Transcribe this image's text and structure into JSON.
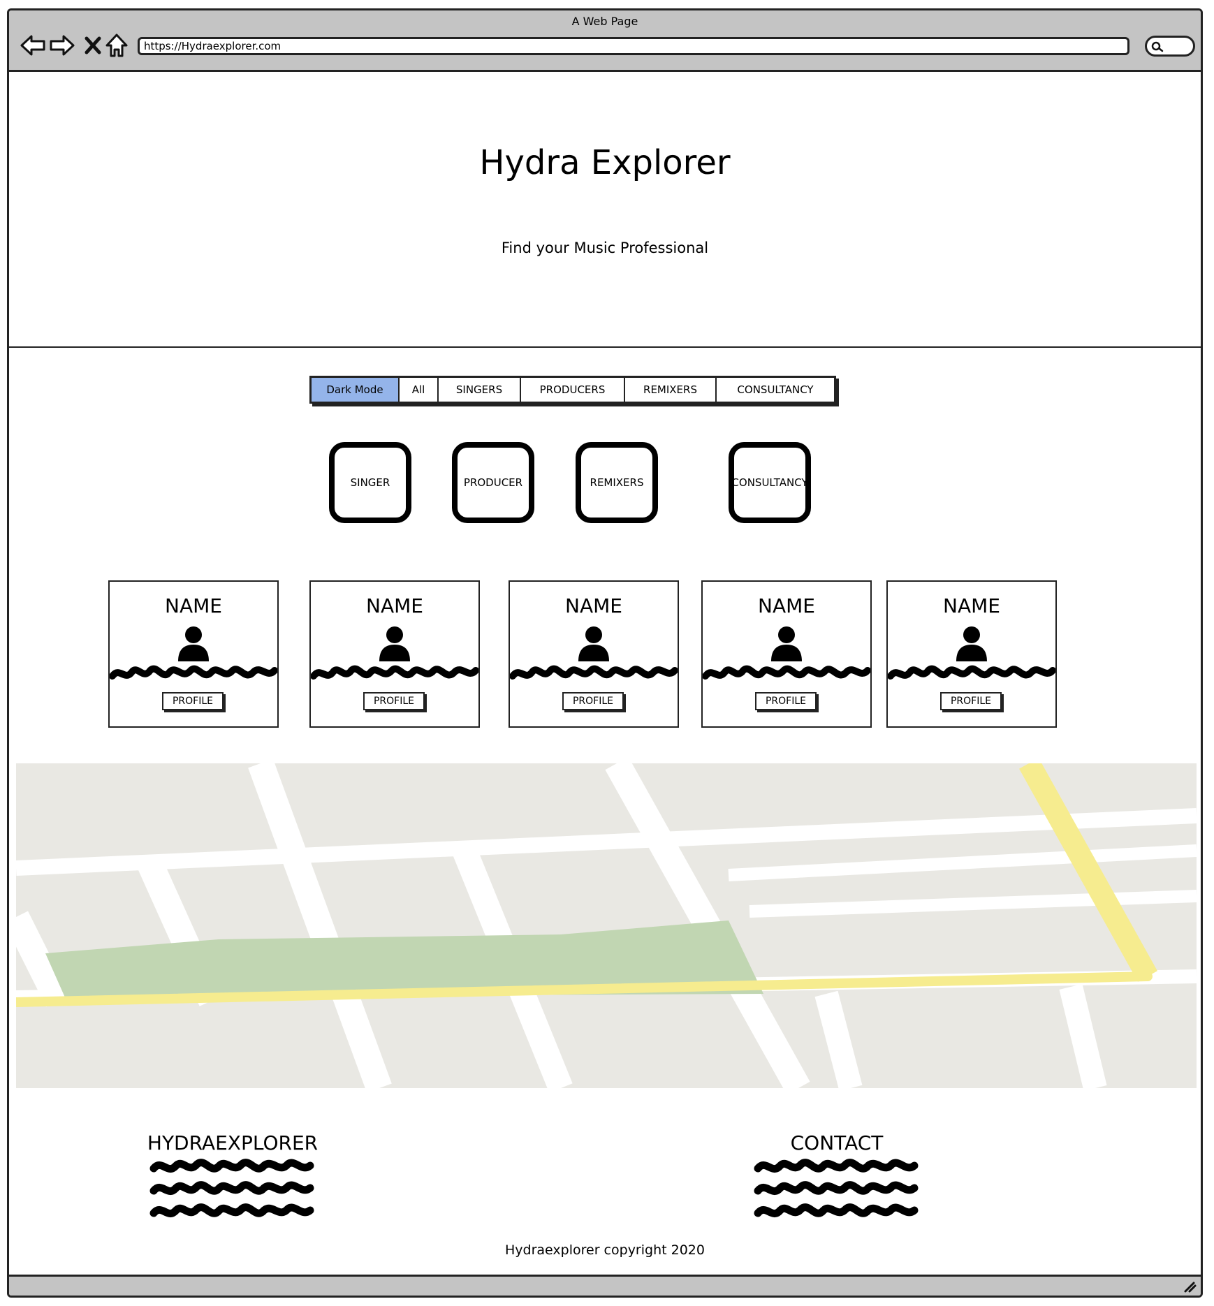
{
  "window": {
    "title": "A Web Page",
    "url": "https://Hydraexplorer.com"
  },
  "header": {
    "title": "Hydra Explorer",
    "tagline": "Find your Music Professional"
  },
  "tabs": [
    {
      "label": "Dark Mode",
      "active": true
    },
    {
      "label": "All",
      "active": false
    },
    {
      "label": "SINGERS",
      "active": false
    },
    {
      "label": "PRODUCERS",
      "active": false
    },
    {
      "label": "REMIXERS",
      "active": false
    },
    {
      "label": "CONSULTANCY",
      "active": false
    }
  ],
  "categories": [
    {
      "label": "SINGER"
    },
    {
      "label": "PRODUCER"
    },
    {
      "label": "REMIXERS"
    },
    {
      "label": "CONSULTANCY"
    }
  ],
  "cards": [
    {
      "name": "NAME",
      "button": "PROFILE"
    },
    {
      "name": "NAME",
      "button": "PROFILE"
    },
    {
      "name": "NAME",
      "button": "PROFILE"
    },
    {
      "name": "NAME",
      "button": "PROFILE"
    },
    {
      "name": "NAME",
      "button": "PROFILE"
    }
  ],
  "footer": {
    "brand_heading": "HYDRAEXPLORER",
    "contact_heading": "CONTACT",
    "copyright": "Hydraexplorer copyright 2020"
  },
  "colors": {
    "chrome": "#c4c4c4",
    "active_tab": "#94b4ea",
    "map_land": "#e9e8e3",
    "map_park": "#c1d6b2",
    "map_highway": "#f6ec8f"
  },
  "icons": [
    "back-arrow-icon",
    "forward-arrow-icon",
    "close-icon",
    "home-icon",
    "search-icon",
    "user-icon",
    "resize-grip-icon"
  ]
}
